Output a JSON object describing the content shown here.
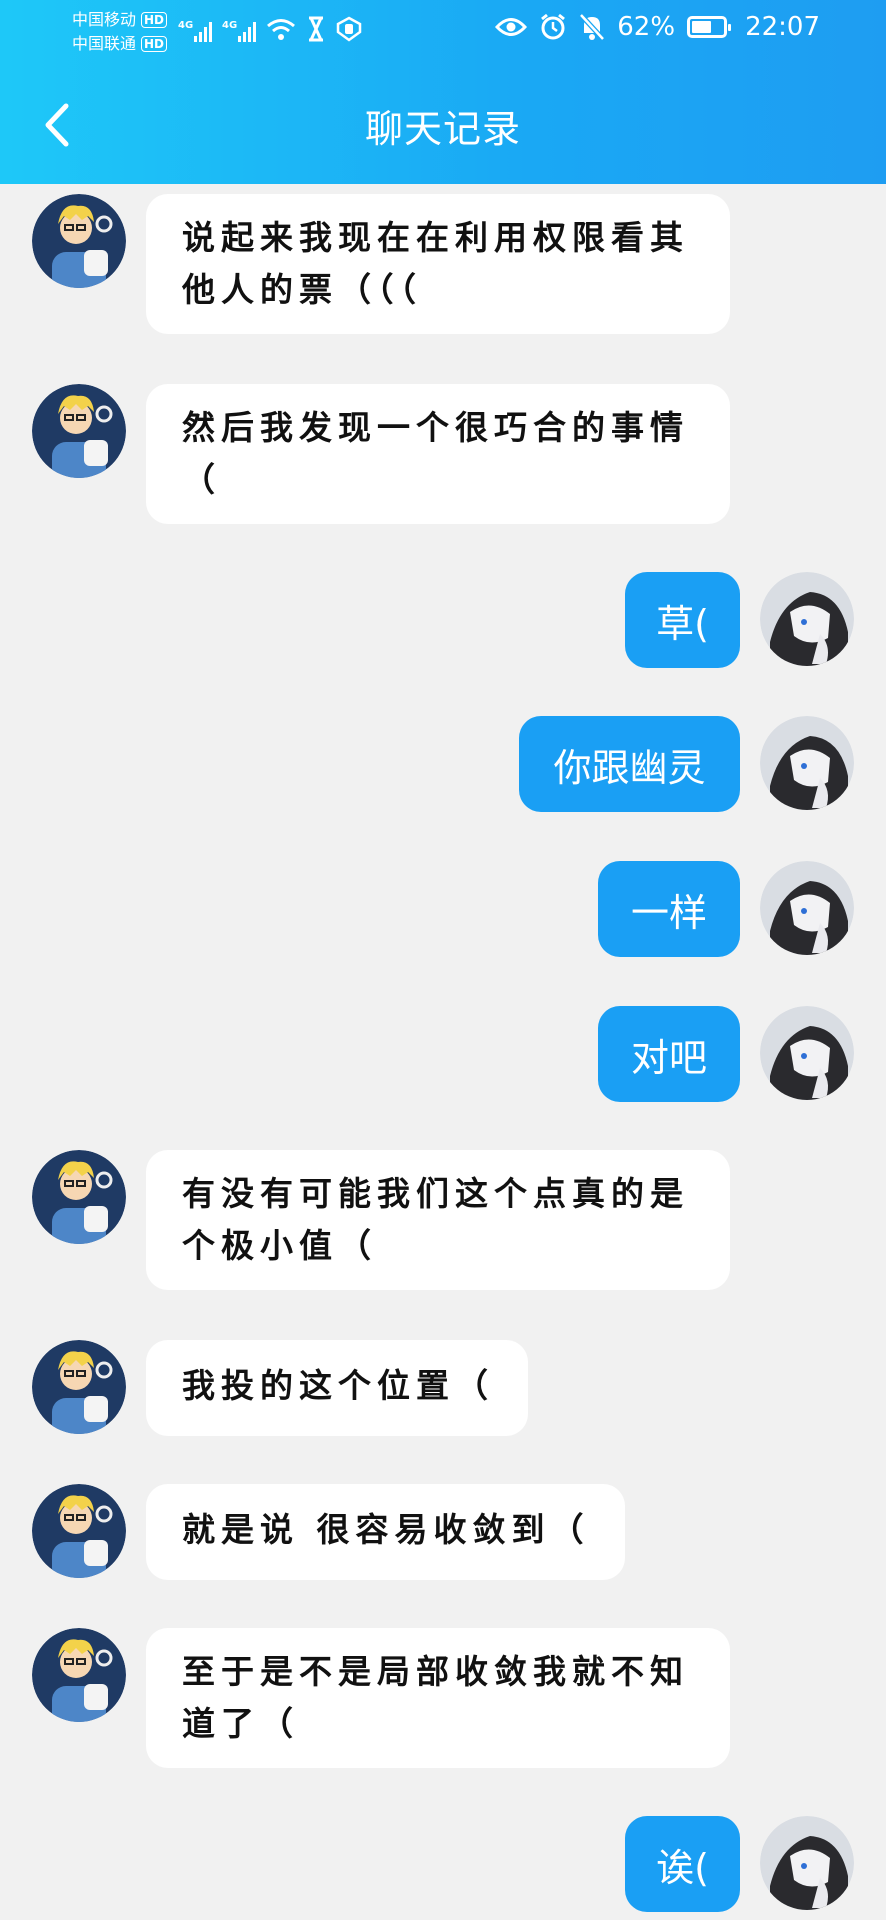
{
  "status_bar": {
    "carrier_1": "中国移动",
    "carrier_2": "中国联通",
    "hd_label": "HD",
    "network_label": "4G",
    "battery_percent": "62%",
    "battery_level": 0.62,
    "time": "22:07"
  },
  "header": {
    "title": "聊天记录",
    "back_icon": "chevron-left-icon"
  },
  "messages": [
    {
      "side": "in",
      "text": "说起来我现在在利用权限看其他人的票（（（"
    },
    {
      "side": "in",
      "text": "然后我发现一个很巧合的事情（"
    },
    {
      "side": "out",
      "text": "草("
    },
    {
      "side": "out",
      "text": "你跟幽灵"
    },
    {
      "side": "out",
      "text": "一样"
    },
    {
      "side": "out",
      "text": "对吧"
    },
    {
      "side": "in",
      "text": "有没有可能我们这个点真的是个极小值（"
    },
    {
      "side": "in",
      "text": "我投的这个位置（"
    },
    {
      "side": "in",
      "text": "就是说 很容易收敛到（"
    },
    {
      "side": "in",
      "text": "至于是不是局部收敛我就不知道了（"
    },
    {
      "side": "out",
      "text": "诶("
    }
  ],
  "colors": {
    "header_gradient_start": "#1ec8f8",
    "header_gradient_end": "#1e9df2",
    "outgoing_bubble": "#1a9ff4",
    "incoming_bubble": "#ffffff",
    "background": "#f1f1f1"
  }
}
